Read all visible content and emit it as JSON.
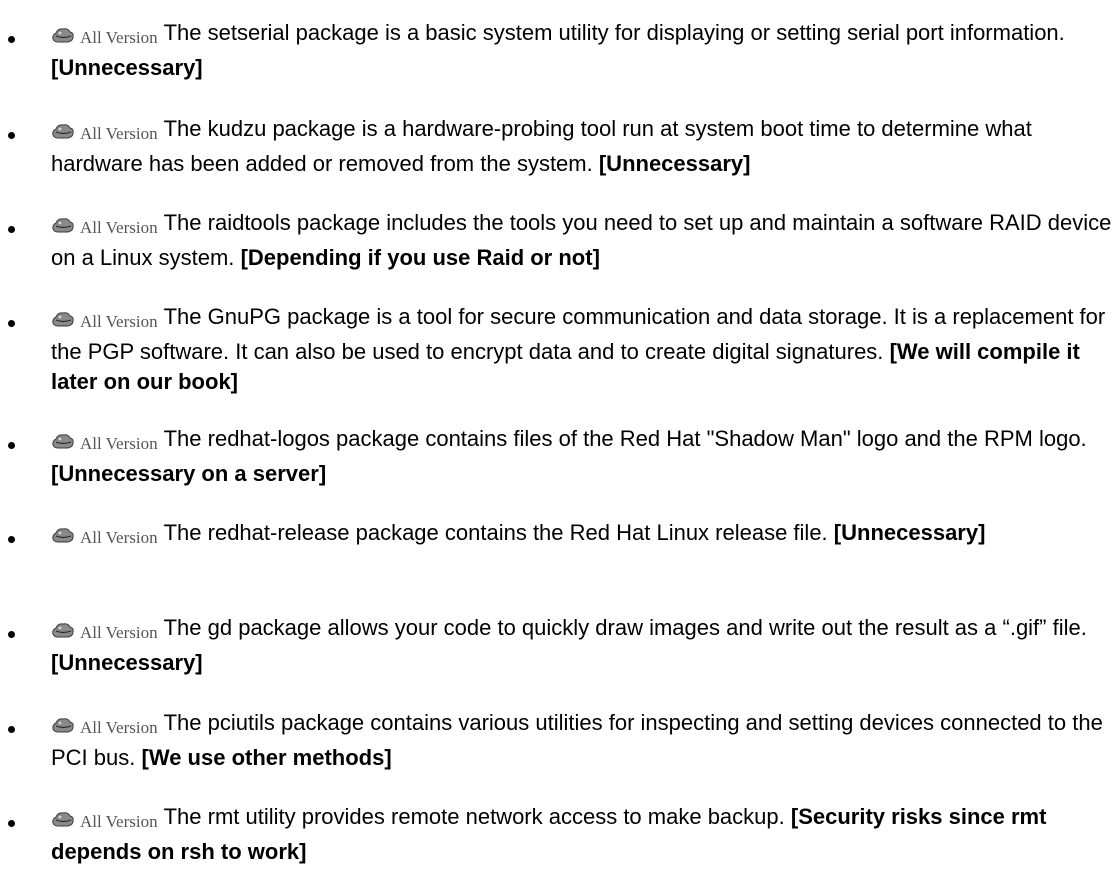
{
  "badge_label": "All Version",
  "items": [
    {
      "text": "The setserial package is a basic system utility for displaying or setting serial port information.",
      "note": "[Unnecessary]"
    },
    {
      "text": "The kudzu package is a hardware-probing tool run at system boot time to determine what hardware has been added or removed from the system.",
      "note": "[Unnecessary]"
    },
    {
      "text": "The raidtools package includes the tools you need to set up and maintain a software RAID device on a Linux system.",
      "note": "[Depending if you use Raid or not]"
    },
    {
      "text": "The GnuPG package is a tool for secure communication and data storage. It is a replacement for the PGP software. It can also be used to encrypt data and to create digital signatures.",
      "note": "[We will compile it later on our book]"
    },
    {
      "text": "The redhat-logos package contains files of the Red Hat \"Shadow Man\" logo and the RPM logo.",
      "note": "[Unnecessary on a server]"
    },
    {
      "text": "The redhat-release package contains the Red Hat Linux release file.",
      "note": "[Unnecessary]"
    },
    {
      "text": "The gd package allows your code to quickly draw images and write out the result as a “.gif” file.",
      "note": "[Unnecessary]"
    },
    {
      "text": "The pciutils package contains various utilities for inspecting and setting devices connected to the PCI bus.",
      "note": "[We use other methods]"
    },
    {
      "text": "The rmt utility provides remote network access to make backup.",
      "note": "[Security risks since rmt depends on rsh to work]"
    }
  ]
}
